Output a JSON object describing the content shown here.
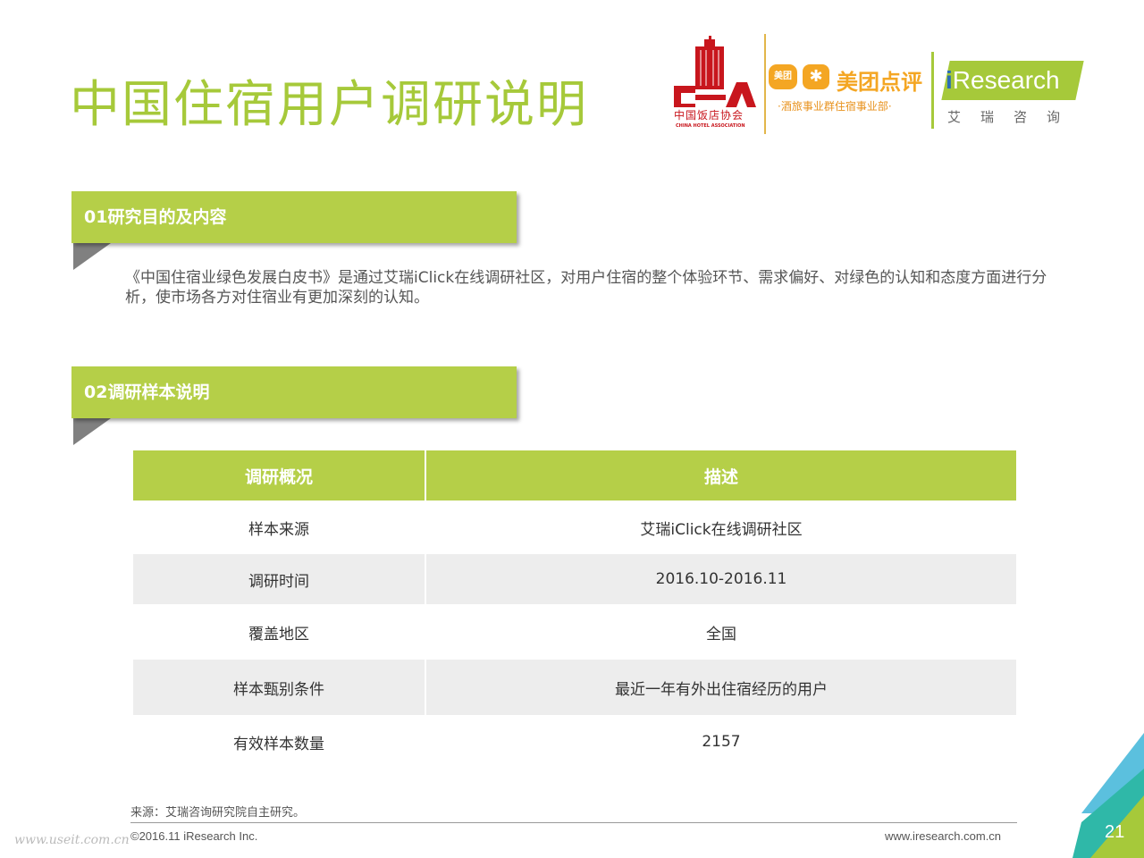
{
  "title": "中国住宿用户调研说明",
  "logos": {
    "cha_cn": "中国饭店协会",
    "cha_en": "CHINA HOTEL ASSOCIATION",
    "meituan_icon": "美团",
    "meituan_name": "美团点评",
    "meituan_sub": "·酒旅事业群住宿事业部·",
    "iresearch_prefix": "i",
    "iresearch_name": "Research",
    "iresearch_cn": "艾瑞咨询"
  },
  "section1": {
    "label": "01研究目的及内容",
    "text": "《中国住宿业绿色发展白皮书》是通过艾瑞iClick在线调研社区，对用户住宿的整个体验环节、需求偏好、对绿色的认知和态度方面进行分析，使市场各方对住宿业有更加深刻的认知。"
  },
  "section2": {
    "label": "02调研样本说明"
  },
  "table": {
    "headers": [
      "调研概况",
      "描述"
    ],
    "rows": [
      [
        "样本来源",
        "艾瑞iClick在线调研社区"
      ],
      [
        "调研时间",
        "2016.10-2016.11"
      ],
      [
        "覆盖地区",
        "全国"
      ],
      [
        "样本甄别条件",
        "最近一年有外出住宿经历的用户"
      ],
      [
        "有效样本数量",
        "2157"
      ]
    ]
  },
  "footer": {
    "source": "来源：艾瑞咨询研究院自主研究。",
    "copyright": "©2016.11 iResearch Inc.",
    "website": "www.iresearch.com.cn",
    "watermark": "www.useit.com.cn",
    "page_number": "21"
  },
  "colors": {
    "accent": "#b5cf48",
    "title": "#a6c93a",
    "alt_row": "#ededed"
  }
}
